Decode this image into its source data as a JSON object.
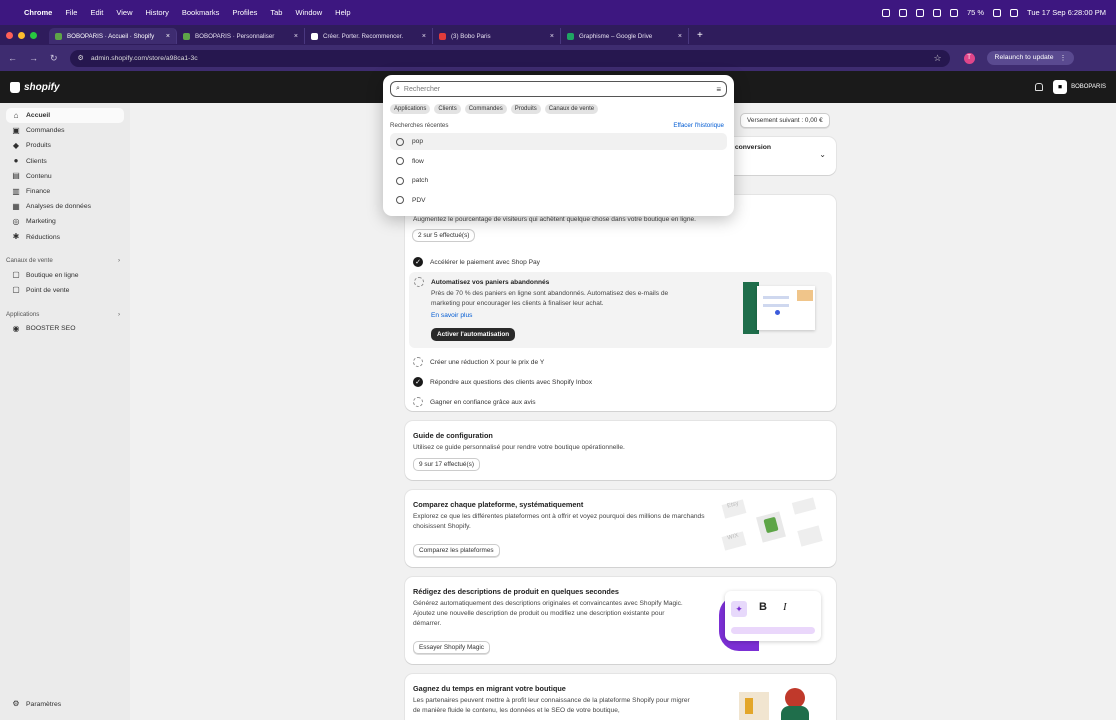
{
  "macbar": {
    "apple": "",
    "menus": [
      "Chrome",
      "File",
      "Edit",
      "View",
      "History",
      "Bookmarks",
      "Profiles",
      "Tab",
      "Window",
      "Help"
    ],
    "battery": "75 %",
    "datetime": "Tue 17 Sep  6:28:00 PM"
  },
  "tabs": [
    {
      "title": "BOBOPARIS · Accueil · Shopify",
      "fav": "#5ea548"
    },
    {
      "title": "BOBOPARIS · Personnaliser",
      "fav": "#5ea548"
    },
    {
      "title": "Créer. Porter. Recommencer.",
      "fav": "#ffffff"
    },
    {
      "title": "(3) Bobo Paris",
      "fav": "#e23b3b"
    },
    {
      "title": "Graphisme – Google Drive",
      "fav": "#1fa463"
    }
  ],
  "address": {
    "url": "admin.shopify.com/store/a98ca1-3c",
    "relaunch": "Relaunch to update",
    "profile": "T"
  },
  "shop": {
    "logo": "shopify",
    "store": "BOBOPARIS"
  },
  "sidebar": {
    "items": [
      {
        "label": "Accueil",
        "icon": "home-icon",
        "glyph": "⌂"
      },
      {
        "label": "Commandes",
        "icon": "inbox-icon",
        "glyph": "▣"
      },
      {
        "label": "Produits",
        "icon": "tag-icon",
        "glyph": "◆"
      },
      {
        "label": "Clients",
        "icon": "person-icon",
        "glyph": "●"
      },
      {
        "label": "Contenu",
        "icon": "document-icon",
        "glyph": "▤"
      },
      {
        "label": "Finance",
        "icon": "bank-icon",
        "glyph": "▥"
      },
      {
        "label": "Analyses de données",
        "icon": "chart-icon",
        "glyph": "▦"
      },
      {
        "label": "Marketing",
        "icon": "target-icon",
        "glyph": "◎"
      },
      {
        "label": "Réductions",
        "icon": "discount-icon",
        "glyph": "✱"
      }
    ],
    "sales_header": "Canaux de vente",
    "sales_items": [
      {
        "label": "Boutique en ligne",
        "icon": "store-icon",
        "glyph": "▢"
      },
      {
        "label": "Point de vente",
        "icon": "pos-icon",
        "glyph": "▢"
      }
    ],
    "apps_header": "Applications",
    "apps_items": [
      {
        "label": "BOOSTER SEO",
        "icon": "app-icon",
        "glyph": "◉"
      }
    ],
    "settings": "Paramètres"
  },
  "search": {
    "value": "Rechercher",
    "filters": [
      "Applications",
      "Clients",
      "Commandes",
      "Produits",
      "Canaux de vente"
    ],
    "recent_label": "Recherches récentes",
    "clear_label": "Effacer l'historique",
    "recent": [
      "pop",
      "flow",
      "patch",
      "PDV"
    ]
  },
  "main": {
    "payout": "Versement suivant : 0,00 €",
    "conversion": "de conversion",
    "conv_card": {
      "desc": "Augmentez le pourcentage de visiteurs qui achètent quelque chose dans votre boutique en ligne.",
      "progress": "2 sur 5 effectué(s)",
      "tasks": [
        "Accélérer le paiement avec Shop Pay",
        "Automatisez vos paniers abandonnés",
        "Créer une réduction X pour le prix de Y",
        "Répondre aux questions des clients avec Shopify Inbox",
        "Gagner en confiance grâce aux avis"
      ],
      "task_desc": "Près de 70 % des paniers en ligne sont abandonnés. Automatisez des e-mails de marketing pour encourager les clients à finaliser leur achat.",
      "learn_more": "En savoir plus",
      "activate": "Activer l'automatisation"
    },
    "guide": {
      "title": "Guide de configuration",
      "desc": "Utilisez ce guide personnalisé pour rendre votre boutique opérationnelle.",
      "progress": "9 sur 17 effectué(s)"
    },
    "compare": {
      "title": "Comparez chaque plateforme, systématiquement",
      "desc": "Explorez ce que les différentes plateformes ont à offrir et voyez pourquoi des millions de marchands choisissent Shopify.",
      "button": "Comparez les plateformes",
      "logos": [
        "Etsy",
        "WIX"
      ]
    },
    "magic": {
      "title": "Rédigez des descriptions de produit en quelques secondes",
      "desc": "Générez automatiquement des descriptions originales et convaincantes avec Shopify Magic. Ajoutez une nouvelle description de produit ou modifiez une description existante pour démarrer.",
      "button": "Essayer Shopify Magic",
      "bold": "B",
      "italic": "I"
    },
    "migrate": {
      "title": "Gagnez du temps en migrant votre boutique",
      "desc": "Les partenaires peuvent mettre à profit leur connaissance de la plateforme Shopify pour migrer de manière fluide le contenu, les données et le SEO de votre boutique,"
    }
  }
}
